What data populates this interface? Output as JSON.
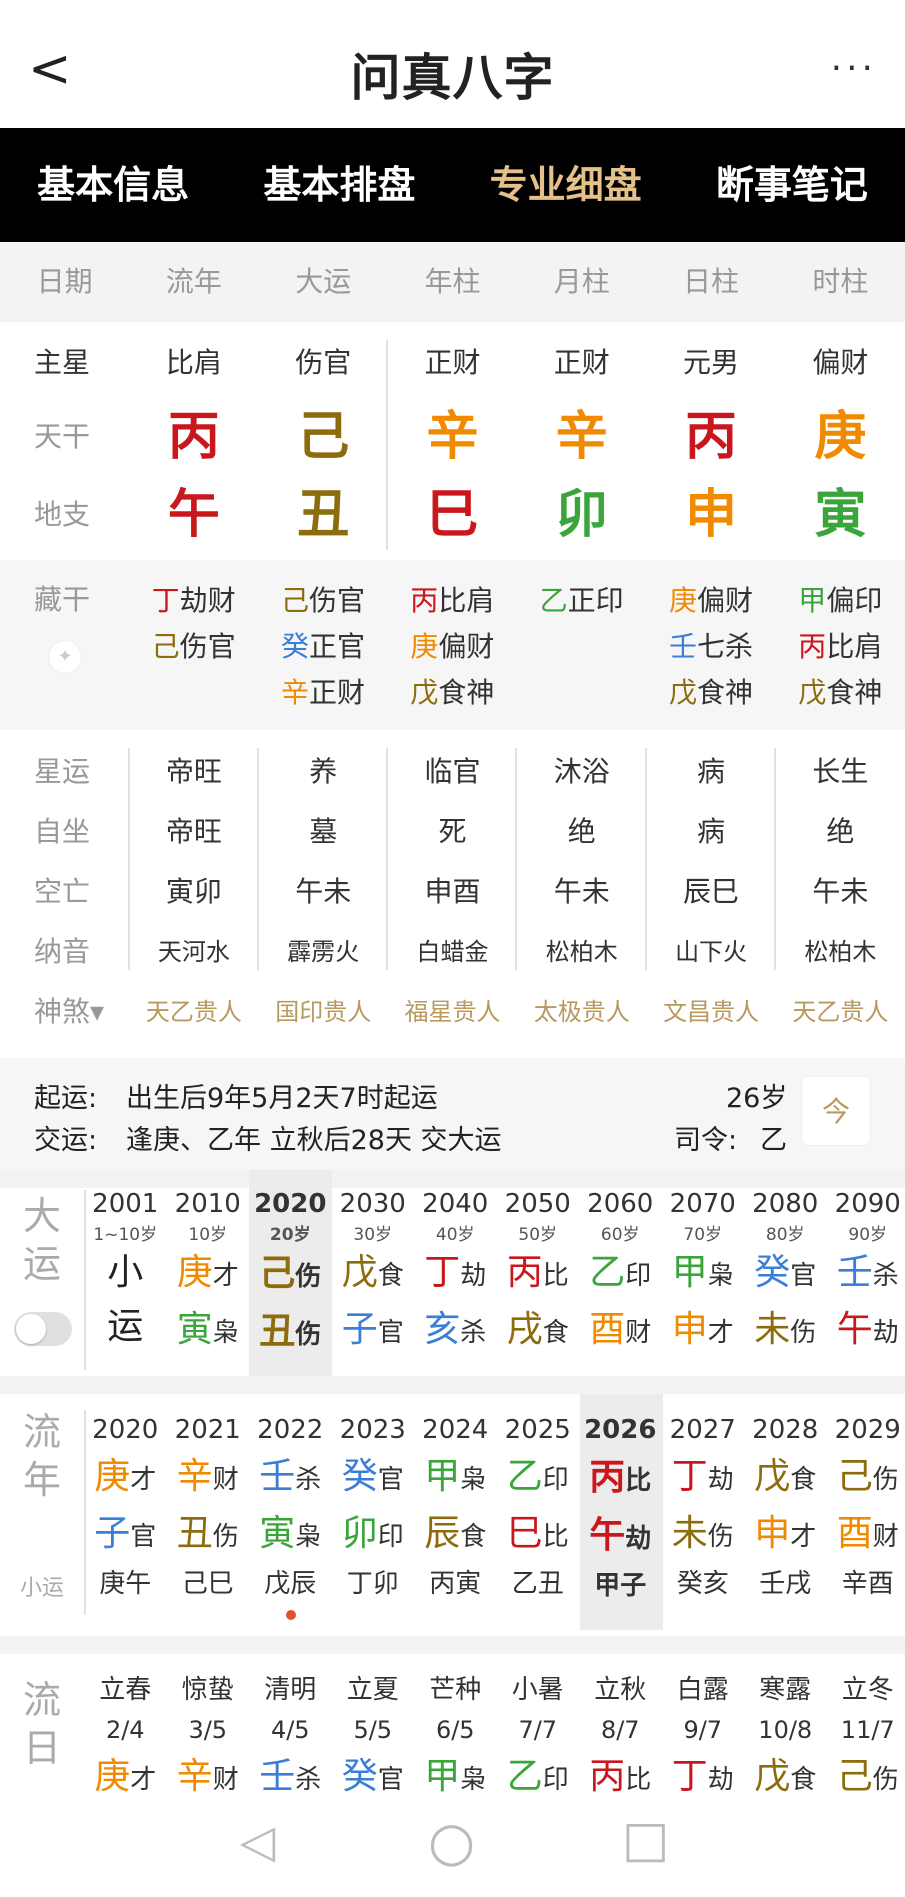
{
  "app": {
    "title": "问真八字",
    "back_icon": "<",
    "more_icon": "···"
  },
  "tabs": [
    "基本信息",
    "基本排盘",
    "专业细盘",
    "断事笔记"
  ],
  "header": [
    "日期",
    "流年",
    "大运",
    "年柱",
    "月柱",
    "日柱",
    "时柱"
  ],
  "labels": {
    "star": "主星",
    "gan": "天干",
    "zhi": "地支",
    "hide": "藏干",
    "xingyun": "星运",
    "zizuo": "自坐",
    "kongwang": "空亡",
    "nayin": "纳音",
    "shensha": "神煞▾"
  },
  "star": [
    "比肩",
    "伤官",
    "正财",
    "正财",
    "元男",
    "偏财"
  ],
  "gan": [
    {
      "t": "丙",
      "c": "red"
    },
    {
      "t": "己",
      "c": "brown"
    },
    {
      "t": "辛",
      "c": "orange"
    },
    {
      "t": "辛",
      "c": "orange"
    },
    {
      "t": "丙",
      "c": "red"
    },
    {
      "t": "庚",
      "c": "orange"
    }
  ],
  "zhi": [
    {
      "t": "午",
      "c": "red"
    },
    {
      "t": "丑",
      "c": "brown"
    },
    {
      "t": "巳",
      "c": "red"
    },
    {
      "t": "卯",
      "c": "green"
    },
    {
      "t": "申",
      "c": "orange"
    },
    {
      "t": "寅",
      "c": "green"
    }
  ],
  "hide": [
    [
      {
        "g": "丁",
        "c": "red",
        "s": "劫财"
      },
      {
        "g": "己",
        "c": "brown",
        "s": "伤官"
      }
    ],
    [
      {
        "g": "己",
        "c": "brown",
        "s": "伤官"
      },
      {
        "g": "癸",
        "c": "blue",
        "s": "正官"
      },
      {
        "g": "辛",
        "c": "orange",
        "s": "正财"
      }
    ],
    [
      {
        "g": "丙",
        "c": "red",
        "s": "比肩"
      },
      {
        "g": "庚",
        "c": "orange",
        "s": "偏财"
      },
      {
        "g": "戊",
        "c": "brown",
        "s": "食神"
      }
    ],
    [
      {
        "g": "乙",
        "c": "green",
        "s": "正印"
      }
    ],
    [
      {
        "g": "庚",
        "c": "orange",
        "s": "偏财"
      },
      {
        "g": "壬",
        "c": "blue",
        "s": "七杀"
      },
      {
        "g": "戊",
        "c": "brown",
        "s": "食神"
      }
    ],
    [
      {
        "g": "甲",
        "c": "green",
        "s": "偏印"
      },
      {
        "g": "丙",
        "c": "red",
        "s": "比肩"
      },
      {
        "g": "戊",
        "c": "brown",
        "s": "食神"
      }
    ]
  ],
  "xingyun": [
    "帝旺",
    "养",
    "临官",
    "沐浴",
    "病",
    "长生"
  ],
  "zizuo": [
    "帝旺",
    "墓",
    "死",
    "绝",
    "病",
    "绝"
  ],
  "kongwang": [
    "寅卯",
    "午未",
    "申酉",
    "午未",
    "辰巳",
    "午未"
  ],
  "nayin": [
    "天河水",
    "霹雳火",
    "白蜡金",
    "松柏木",
    "山下火",
    "松柏木"
  ],
  "shensha": [
    "天乙贵人",
    "国印贵人",
    "福星贵人",
    "太极贵人",
    "文昌贵人",
    "天乙贵人"
  ],
  "info": {
    "qiyun_label": "起运:",
    "qiyun": "出生后9年5月2天7时起运",
    "age": "26岁",
    "jiaoyun_label": "交运:",
    "jiaoyun": "逢庚、乙年 立秋后28天 交大运",
    "siling_label": "司令:",
    "siling": "乙",
    "calendar_icon": "今"
  },
  "dayun": {
    "label": "大运",
    "items": [
      {
        "y": "2001",
        "a": "1~10岁",
        "g": "小",
        "gc": "",
        "gs": "",
        "z": "运",
        "zc": "",
        "zs": ""
      },
      {
        "y": "2010",
        "a": "10岁",
        "g": "庚",
        "gc": "orange",
        "gs": "才",
        "z": "寅",
        "zc": "green",
        "zs": "枭"
      },
      {
        "y": "2020",
        "a": "20岁",
        "g": "己",
        "gc": "brown",
        "gs": "伤",
        "z": "丑",
        "zc": "brown",
        "zs": "伤"
      },
      {
        "y": "2030",
        "a": "30岁",
        "g": "戊",
        "gc": "brown",
        "gs": "食",
        "z": "子",
        "zc": "blue",
        "zs": "官"
      },
      {
        "y": "2040",
        "a": "40岁",
        "g": "丁",
        "gc": "red",
        "gs": "劫",
        "z": "亥",
        "zc": "blue",
        "zs": "杀"
      },
      {
        "y": "2050",
        "a": "50岁",
        "g": "丙",
        "gc": "red",
        "gs": "比",
        "z": "戌",
        "zc": "brown",
        "zs": "食"
      },
      {
        "y": "2060",
        "a": "60岁",
        "g": "乙",
        "gc": "green",
        "gs": "印",
        "z": "酉",
        "zc": "orange",
        "zs": "财"
      },
      {
        "y": "2070",
        "a": "70岁",
        "g": "甲",
        "gc": "green",
        "gs": "枭",
        "z": "申",
        "zc": "orange",
        "zs": "才"
      },
      {
        "y": "2080",
        "a": "80岁",
        "g": "癸",
        "gc": "blue",
        "gs": "官",
        "z": "未",
        "zc": "brown",
        "zs": "伤"
      },
      {
        "y": "2090",
        "a": "90岁",
        "g": "壬",
        "gc": "blue",
        "gs": "杀",
        "z": "午",
        "zc": "red",
        "zs": "劫"
      }
    ]
  },
  "liunian": {
    "label": "流年",
    "sub": "小运",
    "items": [
      {
        "y": "2020",
        "g": "庚",
        "gc": "orange",
        "gs": "才",
        "z": "子",
        "zc": "blue",
        "zs": "官",
        "x": "庚午"
      },
      {
        "y": "2021",
        "g": "辛",
        "gc": "orange",
        "gs": "财",
        "z": "丑",
        "zc": "brown",
        "zs": "伤",
        "x": "己巳"
      },
      {
        "y": "2022",
        "g": "壬",
        "gc": "blue",
        "gs": "杀",
        "z": "寅",
        "zc": "green",
        "zs": "枭",
        "x": "戊辰"
      },
      {
        "y": "2023",
        "g": "癸",
        "gc": "blue",
        "gs": "官",
        "z": "卯",
        "zc": "green",
        "zs": "印",
        "x": "丁卯"
      },
      {
        "y": "2024",
        "g": "甲",
        "gc": "green",
        "gs": "枭",
        "z": "辰",
        "zc": "brown",
        "zs": "食",
        "x": "丙寅"
      },
      {
        "y": "2025",
        "g": "乙",
        "gc": "green",
        "gs": "印",
        "z": "巳",
        "zc": "red",
        "zs": "比",
        "x": "乙丑"
      },
      {
        "y": "2026",
        "g": "丙",
        "gc": "red",
        "gs": "比",
        "z": "午",
        "zc": "red",
        "zs": "劫",
        "x": "甲子"
      },
      {
        "y": "2027",
        "g": "丁",
        "gc": "red",
        "gs": "劫",
        "z": "未",
        "zc": "brown",
        "zs": "伤",
        "x": "癸亥"
      },
      {
        "y": "2028",
        "g": "戊",
        "gc": "brown",
        "gs": "食",
        "z": "申",
        "zc": "orange",
        "zs": "才",
        "x": "壬戌"
      },
      {
        "y": "2029",
        "g": "己",
        "gc": "brown",
        "gs": "伤",
        "z": "酉",
        "zc": "orange",
        "zs": "财",
        "x": "辛酉"
      }
    ]
  },
  "liuri": {
    "label": "流日",
    "items": [
      {
        "j": "立春",
        "d": "2/4",
        "g": "庚",
        "gc": "orange",
        "gs": "才"
      },
      {
        "j": "惊蛰",
        "d": "3/5",
        "g": "辛",
        "gc": "orange",
        "gs": "财"
      },
      {
        "j": "清明",
        "d": "4/5",
        "g": "壬",
        "gc": "blue",
        "gs": "杀"
      },
      {
        "j": "立夏",
        "d": "5/5",
        "g": "癸",
        "gc": "blue",
        "gs": "官"
      },
      {
        "j": "芒种",
        "d": "6/5",
        "g": "甲",
        "gc": "green",
        "gs": "枭"
      },
      {
        "j": "小暑",
        "d": "7/7",
        "g": "乙",
        "gc": "green",
        "gs": "印"
      },
      {
        "j": "立秋",
        "d": "8/7",
        "g": "丙",
        "gc": "red",
        "gs": "比"
      },
      {
        "j": "白露",
        "d": "9/7",
        "g": "丁",
        "gc": "red",
        "gs": "劫"
      },
      {
        "j": "寒露",
        "d": "10/8",
        "g": "戊",
        "gc": "brown",
        "gs": "食"
      },
      {
        "j": "立冬",
        "d": "11/7",
        "g": "己",
        "gc": "brown",
        "gs": "伤"
      }
    ]
  },
  "nav": {
    "back_icon": "◁",
    "home_icon": "○",
    "recent_icon": "□"
  }
}
